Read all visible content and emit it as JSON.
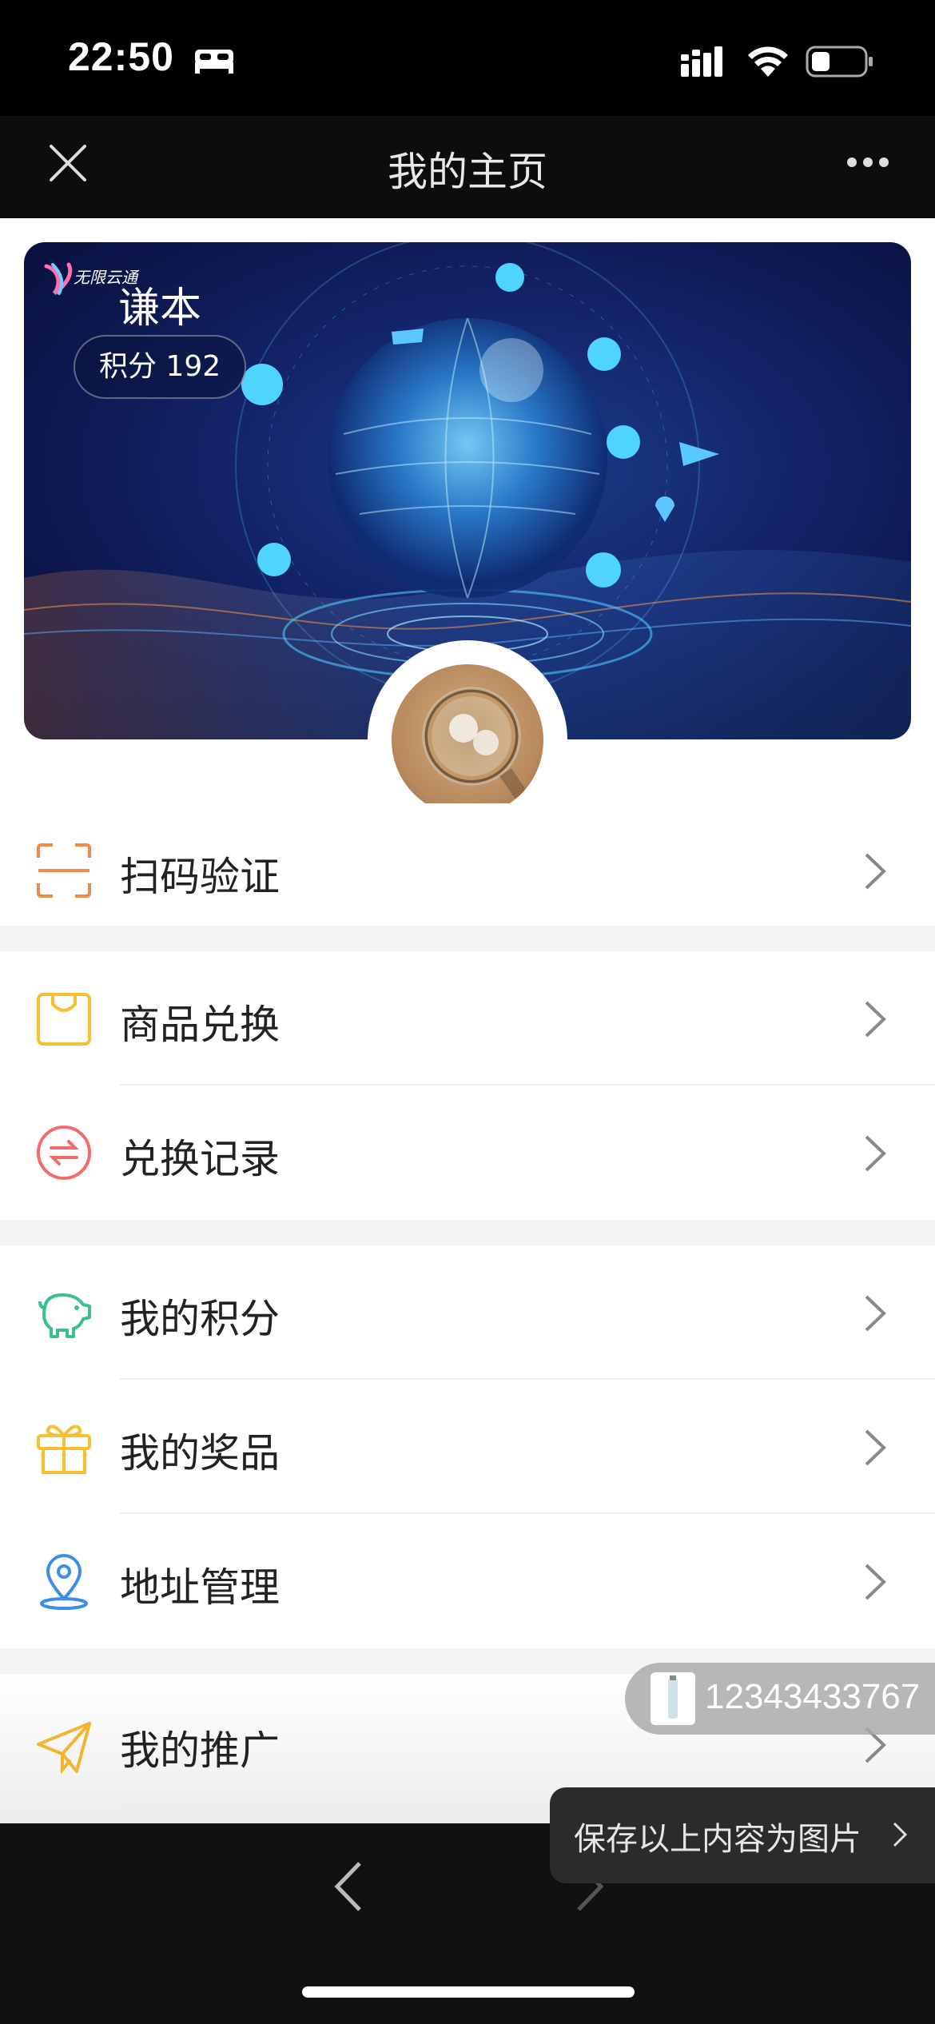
{
  "status_bar": {
    "time": "22:50"
  },
  "nav": {
    "title": "我的主页"
  },
  "profile": {
    "name": "谦本",
    "points_text": "积分 192",
    "logo_text": "无限云通"
  },
  "menu": [
    {
      "label": "扫码验证",
      "icon": "scan-icon",
      "color": "#f08a4b"
    },
    {
      "label": "商品兑换",
      "icon": "shopping-bag-icon",
      "color": "#f5c132"
    },
    {
      "label": "兑换记录",
      "icon": "exchange-icon",
      "color": "#f26b6b"
    },
    {
      "label": "我的积分",
      "icon": "piggy-bank-icon",
      "color": "#3cc08a"
    },
    {
      "label": "我的奖品",
      "icon": "gift-icon",
      "color": "#f5c132"
    },
    {
      "label": "地址管理",
      "icon": "location-pin-icon",
      "color": "#3a8ee6"
    },
    {
      "label": "我的推广",
      "icon": "send-icon",
      "color": "#f5b332"
    }
  ],
  "floating": {
    "phone": "12343433767"
  },
  "save_toast": {
    "label": "保存以上内容为图片"
  }
}
